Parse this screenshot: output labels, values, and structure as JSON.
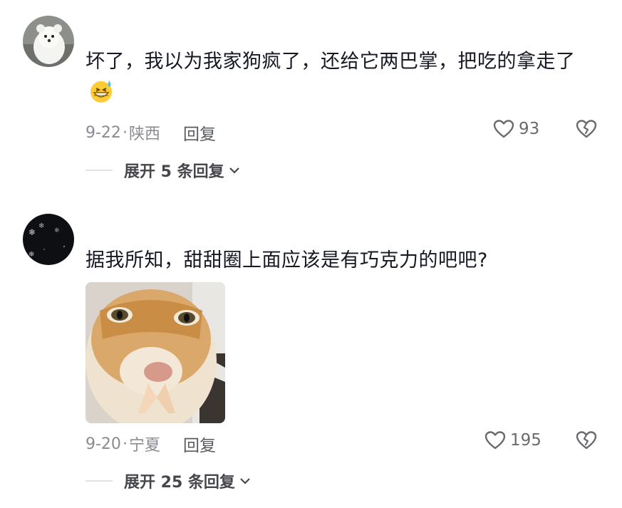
{
  "comments": [
    {
      "text": "坏了，我以为我家狗疯了，还给它两巴掌，把吃的拿走了",
      "emoji": "grinning-sweat-emoji",
      "date": "9-22",
      "location": "陕西",
      "separator": "·",
      "reply_label": "回复",
      "likes": "93",
      "expand_label": "展开 5 条回复"
    },
    {
      "text": "据我所知，甜甜圈上面应该是有巧克力的吧吧?",
      "date": "9-20",
      "location": "宁夏",
      "separator": "·",
      "reply_label": "回复",
      "likes": "195",
      "expand_label": "展开 25 条回复",
      "image": "cat-praying-sticker"
    }
  ],
  "icons": {
    "like": "heart-outline-icon",
    "dislike": "broken-heart-icon",
    "expand": "chevron-down-icon"
  },
  "colors": {
    "text": "#161823",
    "meta": "#8a8b91",
    "icon": "#6a6b70"
  }
}
